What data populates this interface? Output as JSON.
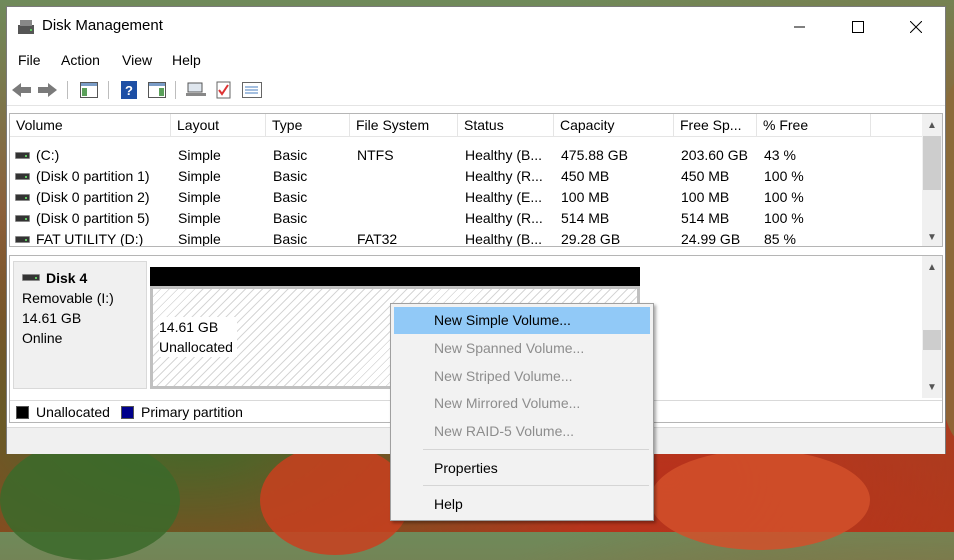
{
  "window": {
    "title": "Disk Management"
  },
  "menu": [
    "File",
    "Action",
    "View",
    "Help"
  ],
  "toolbar": [
    "back-icon",
    "forward-icon",
    "show-hide-console-tree-icon",
    "help-icon",
    "show-hide-action-pane-icon",
    "connect-icon",
    "properties-checklist-icon",
    "list-view-icon"
  ],
  "volume_list": {
    "columns": [
      "Volume",
      "Layout",
      "Type",
      "File System",
      "Status",
      "Capacity",
      "Free Sp...",
      "% Free"
    ],
    "rows": [
      {
        "volume": "(C:)",
        "layout": "Simple",
        "type": "Basic",
        "fs": "NTFS",
        "status": "Healthy (B...",
        "capacity": "475.88 GB",
        "free": "203.60 GB",
        "pct": "43 %"
      },
      {
        "volume": "(Disk 0 partition 1)",
        "layout": "Simple",
        "type": "Basic",
        "fs": "",
        "status": "Healthy (R...",
        "capacity": "450 MB",
        "free": "450 MB",
        "pct": "100 %"
      },
      {
        "volume": "(Disk 0 partition 2)",
        "layout": "Simple",
        "type": "Basic",
        "fs": "",
        "status": "Healthy (E...",
        "capacity": "100 MB",
        "free": "100 MB",
        "pct": "100 %"
      },
      {
        "volume": "(Disk 0 partition 5)",
        "layout": "Simple",
        "type": "Basic",
        "fs": "",
        "status": "Healthy (R...",
        "capacity": "514 MB",
        "free": "514 MB",
        "pct": "100 %"
      },
      {
        "volume": "FAT UTILITY (D:)",
        "layout": "Simple",
        "type": "Basic",
        "fs": "FAT32",
        "status": "Healthy (B...",
        "capacity": "29.28 GB",
        "free": "24.99 GB",
        "pct": "85 %"
      }
    ]
  },
  "disk": {
    "name": "Disk 4",
    "kind": "Removable (I:)",
    "size": "14.61 GB",
    "state": "Online",
    "volume_size": "14.61 GB",
    "volume_state": "Unallocated"
  },
  "legend": [
    {
      "label": "Unallocated",
      "color": "#000000"
    },
    {
      "label": "Primary partition",
      "color": "#00008b"
    }
  ],
  "context_menu": [
    {
      "label": "New Simple Volume...",
      "state": "highlighted"
    },
    {
      "label": "New Spanned Volume...",
      "state": "disabled"
    },
    {
      "label": "New Striped Volume...",
      "state": "disabled"
    },
    {
      "label": "New Mirrored Volume...",
      "state": "disabled"
    },
    {
      "label": "New RAID-5 Volume...",
      "state": "disabled"
    },
    {
      "label": "Properties",
      "state": "enabled"
    },
    {
      "label": "Help",
      "state": "enabled"
    }
  ],
  "colors": {
    "menu_highlight": "#91c9f7",
    "disabled_text": "#8d8d8d"
  }
}
